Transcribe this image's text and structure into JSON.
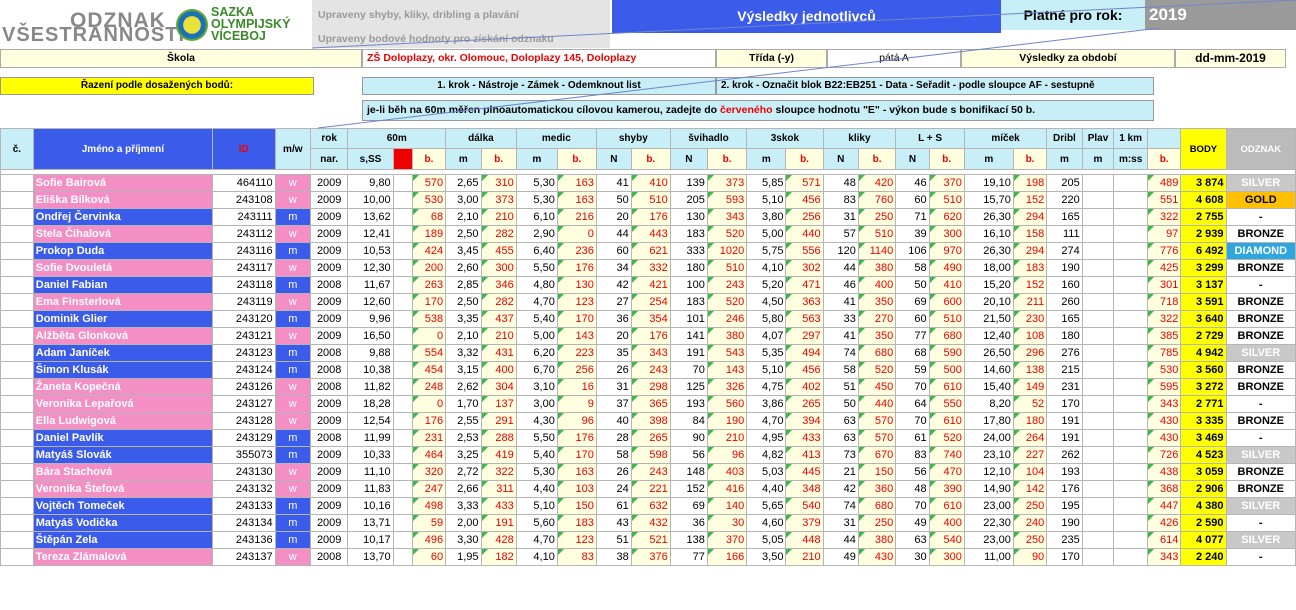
{
  "logo": {
    "line1": "ODZNAK",
    "line2": "VŠESTRANNOSTI",
    "brand": [
      "SAZKA",
      "OLYMPIJSKÝ",
      "VÍCEBOJ"
    ]
  },
  "notes": {
    "line1": "Upraveny shyby, kliky, dribling a plavání",
    "line2": "Upraveny bodové hodnoty pro získání odznaku"
  },
  "title": "Výsledky jednotlivců",
  "valid_label": "Platné pro rok:",
  "year": "2019",
  "info_row": {
    "school_label": "Škola",
    "school_value": "ZŠ Doloplazy, okr. Olomouc, Doloplazy 145, Doloplazy",
    "class_label": "Třída (-y)",
    "class_value": "pátá A",
    "period_label": "Výsledky za období",
    "period_value": "dd-mm-2019"
  },
  "sort_row": {
    "label": "Řazení podle dosažených bodů:",
    "step1": "1. krok - Nástroje - Zámek - Odemknout list",
    "step2": "2. krok - Označit  blok B22:EB251 - Data - Seřadit - podle sloupce AF - sestupně"
  },
  "bonus_note": {
    "part1": "je-li běh na 60m měřen plnoautomatickou cílovou kamerou, zadejte do ",
    "part_red": "červeného",
    "part2": " sloupce hodnotu \"E\" - výkon bude s bonifikací 50 b."
  },
  "headers": {
    "no": "č.",
    "name": "Jméno a příjmení",
    "id": "ID",
    "gender": "m/w",
    "year_top": "rok",
    "year_bottom": "nar.",
    "run": "60m",
    "run_unit": "s,SS",
    "long": "dálka",
    "medic": "medic",
    "pull": "shyby",
    "rope": "švihadlo",
    "triple": "3skok",
    "push": "kliky",
    "ls": "L + S",
    "ball": "míček",
    "dribble": "Dribl",
    "swim": "Plav",
    "km": "1 km",
    "u_b": "b.",
    "u_m": "m",
    "u_n": "N",
    "u_mss": "m:ss",
    "body": "BODY",
    "badge": "ODZNAK"
  },
  "rows": [
    {
      "name": "Sofie Bairová",
      "id": "464110",
      "g": "w",
      "y": "2009",
      "s": "9,80",
      "p1": "570",
      "d": "2,65",
      "p2": "310",
      "md": "5,30",
      "p3": "163",
      "sh": "41",
      "p4": "410",
      "sv": "139",
      "p5": "373",
      "tr": "5,85",
      "p6": "571",
      "kl": "48",
      "p7": "420",
      "ls": "46",
      "p8": "370",
      "mc": "19,10",
      "p9": "198",
      "dr": "205",
      "tot": "489",
      "body": "3 874",
      "badge": "SILVER",
      "bt": "silver"
    },
    {
      "name": "Eliška Bílková",
      "id": "243108",
      "g": "w",
      "y": "2009",
      "s": "10,00",
      "p1": "530",
      "d": "3,00",
      "p2": "373",
      "md": "5,30",
      "p3": "163",
      "sh": "50",
      "p4": "510",
      "sv": "205",
      "p5": "593",
      "tr": "5,10",
      "p6": "456",
      "kl": "83",
      "p7": "760",
      "ls": "60",
      "p8": "510",
      "mc": "15,70",
      "p9": "152",
      "dr": "220",
      "tot": "551",
      "body": "4 608",
      "badge": "GOLD",
      "bt": "gold"
    },
    {
      "name": "Ondřej Červinka",
      "id": "243111",
      "g": "m",
      "y": "2009",
      "s": "13,62",
      "p1": "68",
      "d": "2,10",
      "p2": "210",
      "md": "6,10",
      "p3": "216",
      "sh": "20",
      "p4": "176",
      "sv": "130",
      "p5": "343",
      "tr": "3,80",
      "p6": "256",
      "kl": "31",
      "p7": "250",
      "ls": "71",
      "p8": "620",
      "mc": "26,30",
      "p9": "294",
      "dr": "165",
      "tot": "322",
      "body": "2 755",
      "badge": "-",
      "bt": "none"
    },
    {
      "name": "Stela Čihalová",
      "id": "243112",
      "g": "w",
      "y": "2009",
      "s": "12,41",
      "p1": "189",
      "d": "2,50",
      "p2": "282",
      "md": "2,90",
      "p3": "0",
      "sh": "44",
      "p4": "443",
      "sv": "183",
      "p5": "520",
      "tr": "5,00",
      "p6": "440",
      "kl": "57",
      "p7": "510",
      "ls": "39",
      "p8": "300",
      "mc": "16,10",
      "p9": "158",
      "dr": "111",
      "tot": "97",
      "body": "2 939",
      "badge": "BRONZE",
      "bt": "bronze"
    },
    {
      "name": "Prokop Duda",
      "id": "243116",
      "g": "m",
      "y": "2009",
      "s": "10,53",
      "p1": "424",
      "d": "3,45",
      "p2": "455",
      "md": "6,40",
      "p3": "236",
      "sh": "60",
      "p4": "621",
      "sv": "333",
      "p5": "1020",
      "tr": "5,75",
      "p6": "556",
      "kl": "120",
      "p7": "1140",
      "ls": "106",
      "p8": "970",
      "mc": "26,30",
      "p9": "294",
      "dr": "274",
      "tot": "776",
      "body": "6 492",
      "badge": "DIAMOND",
      "bt": "diamond"
    },
    {
      "name": "Sofie Dvouletá",
      "id": "243117",
      "g": "w",
      "y": "2009",
      "s": "12,30",
      "p1": "200",
      "d": "2,60",
      "p2": "300",
      "md": "5,50",
      "p3": "176",
      "sh": "34",
      "p4": "332",
      "sv": "180",
      "p5": "510",
      "tr": "4,10",
      "p6": "302",
      "kl": "44",
      "p7": "380",
      "ls": "58",
      "p8": "490",
      "mc": "18,00",
      "p9": "183",
      "dr": "190",
      "tot": "425",
      "body": "3 299",
      "badge": "BRONZE",
      "bt": "bronze"
    },
    {
      "name": "Daniel Fabian",
      "id": "243118",
      "g": "m",
      "y": "2008",
      "s": "11,67",
      "p1": "263",
      "d": "2,85",
      "p2": "346",
      "md": "4,80",
      "p3": "130",
      "sh": "42",
      "p4": "421",
      "sv": "100",
      "p5": "243",
      "tr": "5,20",
      "p6": "471",
      "kl": "46",
      "p7": "400",
      "ls": "50",
      "p8": "410",
      "mc": "15,20",
      "p9": "152",
      "dr": "160",
      "tot": "301",
      "body": "3 137",
      "badge": "-",
      "bt": "none"
    },
    {
      "name": "Ema Finsterlová",
      "id": "243119",
      "g": "w",
      "y": "2009",
      "s": "12,60",
      "p1": "170",
      "d": "2,50",
      "p2": "282",
      "md": "4,70",
      "p3": "123",
      "sh": "27",
      "p4": "254",
      "sv": "183",
      "p5": "520",
      "tr": "4,50",
      "p6": "363",
      "kl": "41",
      "p7": "350",
      "ls": "69",
      "p8": "600",
      "mc": "20,10",
      "p9": "211",
      "dr": "260",
      "tot": "718",
      "body": "3 591",
      "badge": "BRONZE",
      "bt": "bronze"
    },
    {
      "name": "Dominik Glier",
      "id": "243120",
      "g": "m",
      "y": "2009",
      "s": "9,96",
      "p1": "538",
      "d": "3,35",
      "p2": "437",
      "md": "5,40",
      "p3": "170",
      "sh": "36",
      "p4": "354",
      "sv": "101",
      "p5": "246",
      "tr": "5,80",
      "p6": "563",
      "kl": "33",
      "p7": "270",
      "ls": "60",
      "p8": "510",
      "mc": "21,50",
      "p9": "230",
      "dr": "165",
      "tot": "322",
      "body": "3 640",
      "badge": "BRONZE",
      "bt": "bronze"
    },
    {
      "name": "Alžběta Glonková",
      "id": "243121",
      "g": "w",
      "y": "2009",
      "s": "16,50",
      "p1": "0",
      "d": "2,10",
      "p2": "210",
      "md": "5,00",
      "p3": "143",
      "sh": "20",
      "p4": "176",
      "sv": "141",
      "p5": "380",
      "tr": "4,07",
      "p6": "297",
      "kl": "41",
      "p7": "350",
      "ls": "77",
      "p8": "680",
      "mc": "12,40",
      "p9": "108",
      "dr": "180",
      "tot": "385",
      "body": "2 729",
      "badge": "BRONZE",
      "bt": "bronze"
    },
    {
      "name": "Adam Janíček",
      "id": "243123",
      "g": "m",
      "y": "2008",
      "s": "9,88",
      "p1": "554",
      "d": "3,32",
      "p2": "431",
      "md": "6,20",
      "p3": "223",
      "sh": "35",
      "p4": "343",
      "sv": "191",
      "p5": "543",
      "tr": "5,35",
      "p6": "494",
      "kl": "74",
      "p7": "680",
      "ls": "68",
      "p8": "590",
      "mc": "26,50",
      "p9": "296",
      "dr": "276",
      "tot": "785",
      "body": "4 942",
      "badge": "SILVER",
      "bt": "silver"
    },
    {
      "name": "Šimon Klusák",
      "id": "243124",
      "g": "m",
      "y": "2008",
      "s": "10,38",
      "p1": "454",
      "d": "3,15",
      "p2": "400",
      "md": "6,70",
      "p3": "256",
      "sh": "26",
      "p4": "243",
      "sv": "70",
      "p5": "143",
      "tr": "5,10",
      "p6": "456",
      "kl": "58",
      "p7": "520",
      "ls": "59",
      "p8": "500",
      "mc": "14,60",
      "p9": "138",
      "dr": "215",
      "tot": "530",
      "body": "3 560",
      "badge": "BRONZE",
      "bt": "bronze"
    },
    {
      "name": "Žaneta Kopečná",
      "id": "243126",
      "g": "w",
      "y": "2008",
      "s": "11,82",
      "p1": "248",
      "d": "2,62",
      "p2": "304",
      "md": "3,10",
      "p3": "16",
      "sh": "31",
      "p4": "298",
      "sv": "125",
      "p5": "326",
      "tr": "4,75",
      "p6": "402",
      "kl": "51",
      "p7": "450",
      "ls": "70",
      "p8": "610",
      "mc": "15,40",
      "p9": "149",
      "dr": "231",
      "tot": "595",
      "body": "3 272",
      "badge": "BRONZE",
      "bt": "bronze"
    },
    {
      "name": "Veronika Lepařová",
      "id": "243127",
      "g": "w",
      "y": "2009",
      "s": "18,28",
      "p1": "0",
      "d": "1,70",
      "p2": "137",
      "md": "3,00",
      "p3": "9",
      "sh": "37",
      "p4": "365",
      "sv": "193",
      "p5": "560",
      "tr": "3,86",
      "p6": "265",
      "kl": "50",
      "p7": "440",
      "ls": "64",
      "p8": "550",
      "mc": "8,20",
      "p9": "52",
      "dr": "170",
      "tot": "343",
      "body": "2 771",
      "badge": "-",
      "bt": "none"
    },
    {
      "name": "Ella Ludwigová",
      "id": "243128",
      "g": "w",
      "y": "2009",
      "s": "12,54",
      "p1": "176",
      "d": "2,55",
      "p2": "291",
      "md": "4,30",
      "p3": "96",
      "sh": "40",
      "p4": "398",
      "sv": "84",
      "p5": "190",
      "tr": "4,70",
      "p6": "394",
      "kl": "63",
      "p7": "570",
      "ls": "70",
      "p8": "610",
      "mc": "17,80",
      "p9": "180",
      "dr": "191",
      "tot": "430",
      "body": "3 335",
      "badge": "BRONZE",
      "bt": "bronze"
    },
    {
      "name": "Daniel Pavlík",
      "id": "243129",
      "g": "m",
      "y": "2008",
      "s": "11,99",
      "p1": "231",
      "d": "2,53",
      "p2": "288",
      "md": "5,50",
      "p3": "176",
      "sh": "28",
      "p4": "265",
      "sv": "90",
      "p5": "210",
      "tr": "4,95",
      "p6": "433",
      "kl": "63",
      "p7": "570",
      "ls": "61",
      "p8": "520",
      "mc": "24,00",
      "p9": "264",
      "dr": "191",
      "tot": "430",
      "body": "3 469",
      "badge": "-",
      "bt": "none"
    },
    {
      "name": "Matyáš Slovák",
      "id": "355073",
      "g": "m",
      "y": "2009",
      "s": "10,33",
      "p1": "464",
      "d": "3,25",
      "p2": "419",
      "md": "5,40",
      "p3": "170",
      "sh": "58",
      "p4": "598",
      "sv": "56",
      "p5": "96",
      "tr": "4,82",
      "p6": "413",
      "kl": "73",
      "p7": "670",
      "ls": "83",
      "p8": "740",
      "mc": "23,10",
      "p9": "227",
      "dr": "262",
      "tot": "726",
      "body": "4 523",
      "badge": "SILVER",
      "bt": "silver"
    },
    {
      "name": "Bára Stachová",
      "id": "243130",
      "g": "w",
      "y": "2009",
      "s": "11,10",
      "p1": "320",
      "d": "2,72",
      "p2": "322",
      "md": "5,30",
      "p3": "163",
      "sh": "26",
      "p4": "243",
      "sv": "148",
      "p5": "403",
      "tr": "5,03",
      "p6": "445",
      "kl": "21",
      "p7": "150",
      "ls": "56",
      "p8": "470",
      "mc": "12,10",
      "p9": "104",
      "dr": "193",
      "tot": "438",
      "body": "3 059",
      "badge": "BRONZE",
      "bt": "bronze"
    },
    {
      "name": "Veronika Štefová",
      "id": "243132",
      "g": "w",
      "y": "2009",
      "s": "11,83",
      "p1": "247",
      "d": "2,66",
      "p2": "311",
      "md": "4,40",
      "p3": "103",
      "sh": "24",
      "p4": "221",
      "sv": "152",
      "p5": "416",
      "tr": "4,40",
      "p6": "348",
      "kl": "42",
      "p7": "360",
      "ls": "48",
      "p8": "390",
      "mc": "14,90",
      "p9": "142",
      "dr": "176",
      "tot": "368",
      "body": "2 906",
      "badge": "BRONZE",
      "bt": "bronze"
    },
    {
      "name": "Vojtěch Tomeček",
      "id": "243133",
      "g": "m",
      "y": "2009",
      "s": "10,16",
      "p1": "498",
      "d": "3,33",
      "p2": "433",
      "md": "5,10",
      "p3": "150",
      "sh": "61",
      "p4": "632",
      "sv": "69",
      "p5": "140",
      "tr": "5,65",
      "p6": "540",
      "kl": "74",
      "p7": "680",
      "ls": "70",
      "p8": "610",
      "mc": "23,00",
      "p9": "250",
      "dr": "195",
      "tot": "447",
      "body": "4 380",
      "badge": "SILVER",
      "bt": "silver"
    },
    {
      "name": "Matyáš Vodička",
      "id": "243134",
      "g": "m",
      "y": "2009",
      "s": "13,71",
      "p1": "59",
      "d": "2,00",
      "p2": "191",
      "md": "5,60",
      "p3": "183",
      "sh": "43",
      "p4": "432",
      "sv": "36",
      "p5": "30",
      "tr": "4,60",
      "p6": "379",
      "kl": "31",
      "p7": "250",
      "ls": "49",
      "p8": "400",
      "mc": "22,30",
      "p9": "240",
      "dr": "190",
      "tot": "426",
      "body": "2 590",
      "badge": "-",
      "bt": "none"
    },
    {
      "name": "Štěpán Zela",
      "id": "243136",
      "g": "m",
      "y": "2009",
      "s": "10,17",
      "p1": "496",
      "d": "3,30",
      "p2": "428",
      "md": "4,70",
      "p3": "123",
      "sh": "51",
      "p4": "521",
      "sv": "138",
      "p5": "370",
      "tr": "5,05",
      "p6": "448",
      "kl": "44",
      "p7": "380",
      "ls": "63",
      "p8": "540",
      "mc": "23,00",
      "p9": "250",
      "dr": "235",
      "tot": "614",
      "body": "4 077",
      "badge": "SILVER",
      "bt": "silver"
    },
    {
      "name": "Tereza Zlámalová",
      "id": "243137",
      "g": "w",
      "y": "2008",
      "s": "13,70",
      "p1": "60",
      "d": "1,95",
      "p2": "182",
      "md": "4,10",
      "p3": "83",
      "sh": "38",
      "p4": "376",
      "sv": "77",
      "p5": "166",
      "tr": "3,50",
      "p6": "210",
      "kl": "49",
      "p7": "430",
      "ls": "30",
      "p8": "300",
      "mc": "11,00",
      "p9": "90",
      "dr": "170",
      "tot": "343",
      "body": "2 240",
      "badge": "-",
      "bt": "none"
    }
  ]
}
